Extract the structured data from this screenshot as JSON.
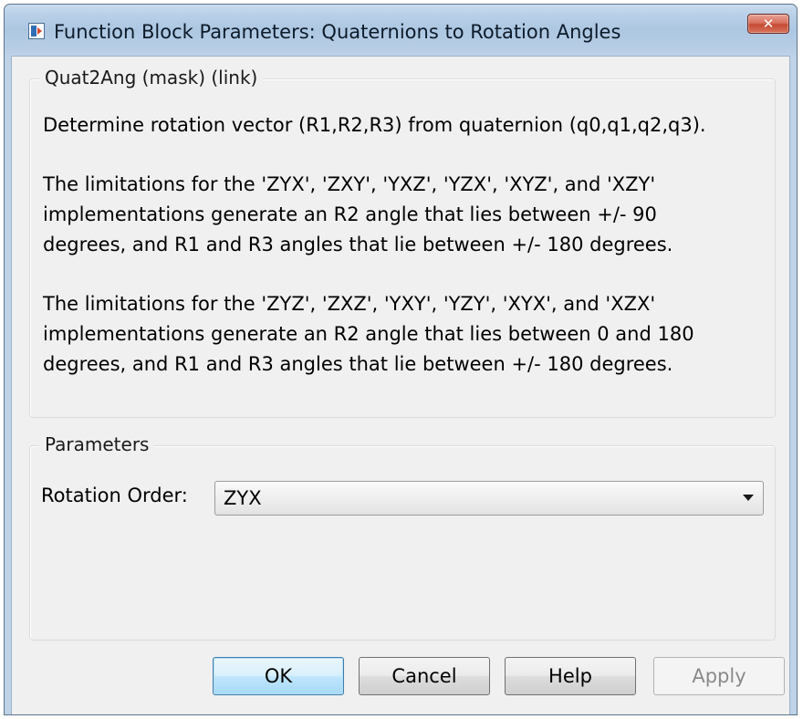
{
  "window": {
    "title": "Function Block Parameters: Quaternions to Rotation Angles",
    "app_icon": "simulink-block-icon",
    "close_icon": "close-icon"
  },
  "description": {
    "group_label": "Quat2Ang (mask) (link)",
    "paragraphs": [
      "Determine rotation vector (R1,R2,R3) from quaternion (q0,q1,q2,q3).",
      "The limitations for the 'ZYX', 'ZXY', 'YXZ', 'YZX', 'XYZ', and 'XZY'\nimplementations generate an R2 angle that lies between +/- 90\ndegrees, and R1 and R3 angles that lie between +/- 180 degrees.",
      "The limitations for the 'ZYZ', 'ZXZ', 'YXY', 'YZY', 'XYX', and 'XZX'\nimplementations generate an R2 angle that lies between 0 and 180\ndegrees, and R1 and R3 angles that lie between +/- 180 degrees."
    ]
  },
  "parameters": {
    "group_label": "Parameters",
    "rotation_order": {
      "label": "Rotation Order:",
      "value": "ZYX",
      "icon": "chevron-down-icon"
    }
  },
  "buttons": {
    "ok": "OK",
    "cancel": "Cancel",
    "help": "Help",
    "apply": "Apply"
  },
  "colors": {
    "titlebar": "#b8cfe7",
    "dialog_bg": "#f0f0f0",
    "close_button": "#c64a33",
    "default_button_border": "#3c7fb1"
  }
}
